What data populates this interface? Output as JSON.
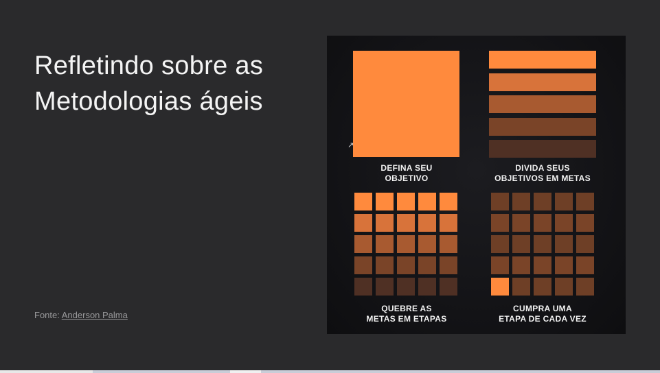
{
  "slide": {
    "title": "Refletindo sobre as\nMetodologias ágeis",
    "source_prefix": "Fonte: ",
    "source_link": "Anderson Palma"
  },
  "infographic": {
    "labels": [
      "DEFINA SEU\nOBJETIVO",
      "DIVIDA SEUS\nOBJETIVOS EM METAS",
      "QUEBRE AS\nMETAS EM ETAPAS",
      "CUMPRA UMA\nETAPA DE CADA VEZ"
    ],
    "colors": {
      "big_square": "#ff8a3d",
      "bars": [
        "#ff8a3d",
        "#d8733a",
        "#a85a30",
        "#7a4428",
        "#4f3024"
      ],
      "grid_rows": [
        "#ff8a3d",
        "#d8733a",
        "#a85a30",
        "#7a4428",
        "#4f3024"
      ],
      "done_grid_base": "#6e3f26",
      "done_grid_row_alt": "#7a4428",
      "done_highlight": "#ff8a3d"
    },
    "done_grid_completed_cells": 1
  }
}
